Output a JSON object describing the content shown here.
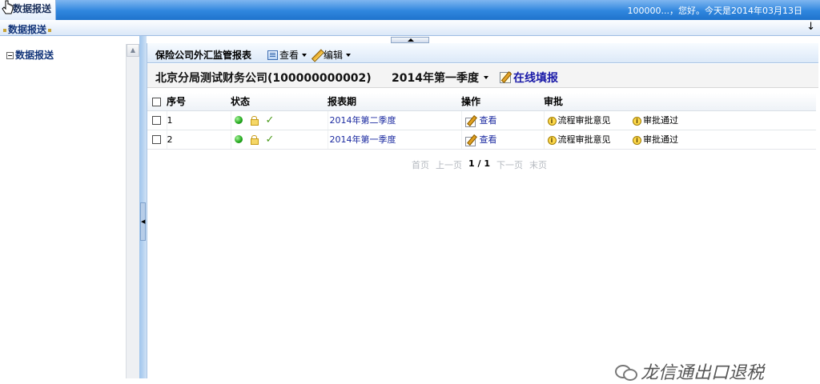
{
  "top": {
    "tab_label": "数据报送",
    "greeting": "100000...，您好。今天是2014年03月13日"
  },
  "subbar": {
    "title": "数据报送",
    "arrow": "↓"
  },
  "sidebar": {
    "tree_toggle": "⊟",
    "root_label": "数据报送"
  },
  "toolbar": {
    "title": "保险公司外汇监管报表",
    "view_label": "查看",
    "edit_label": "编辑"
  },
  "info": {
    "company": "北京分局测试财务公司(100000000002)",
    "period": "2014年第一季度",
    "online_fill_label": "在线填报"
  },
  "table": {
    "headers": {
      "index": "序号",
      "status": "状态",
      "period": "报表期",
      "action": "操作",
      "approval": "审批"
    },
    "rows": [
      {
        "index": "1",
        "period": "2014年第二季度",
        "action": "查看",
        "approval_opinion": "流程审批意见",
        "approval_pass": "审批通过"
      },
      {
        "index": "2",
        "period": "2014年第一季度",
        "action": "查看",
        "approval_opinion": "流程审批意见",
        "approval_pass": "审批通过"
      }
    ]
  },
  "pager": {
    "first": "首页",
    "prev": "上一页",
    "current": "1 / 1",
    "next": "下一页",
    "last": "末页"
  },
  "watermark": {
    "text": "龙信通出口退税"
  },
  "colors": {
    "topbar_blue": "#2f86de",
    "link_blue": "#1b2aa0",
    "status_green": "#20a51a"
  },
  "icons": [
    "cursor-icon",
    "view-icon",
    "pencil-icon",
    "note-icon",
    "status-dot-icon",
    "lock-icon",
    "check-icon",
    "edit-icon",
    "info-icon",
    "wechat-icon"
  ]
}
